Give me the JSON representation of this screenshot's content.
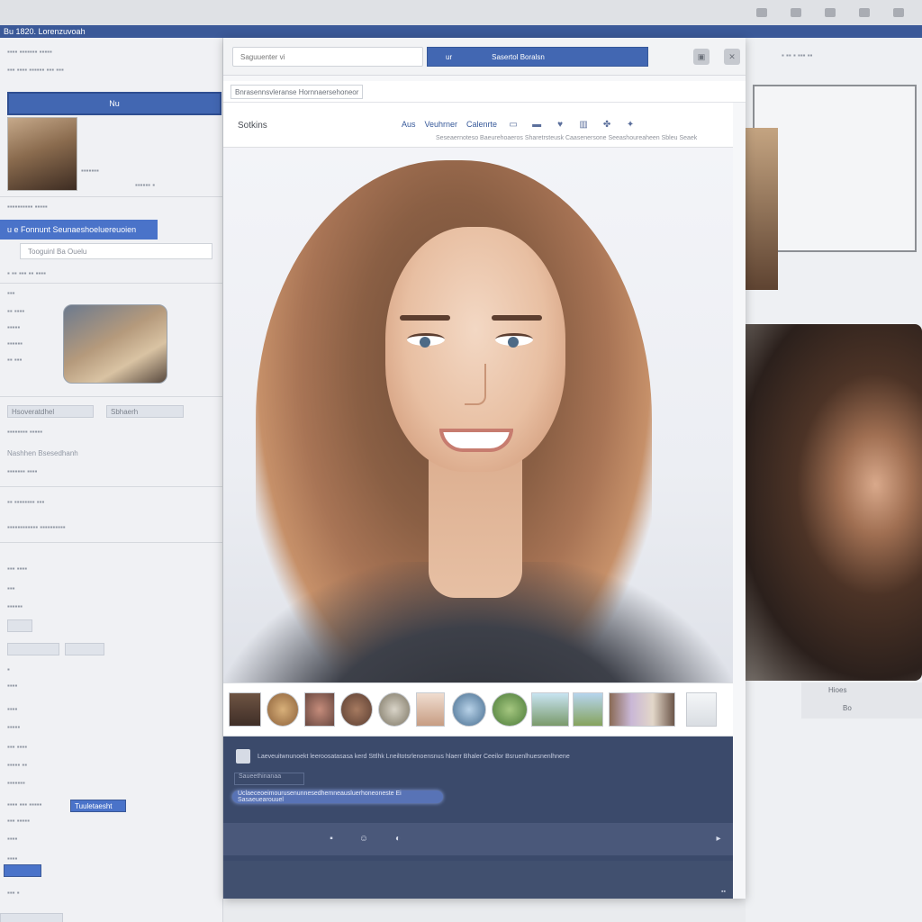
{
  "browser": {
    "title": ""
  },
  "top_bar": {
    "label": "Bu 1820. Lorenzuvoah"
  },
  "left_panel": {
    "header_label": "Nu",
    "tag_label": "u e Fonnunt Seunaeshoeluereuoien",
    "search_placeholder": "Tooguinl Ba Ouelu",
    "caption_1": "Nashhen Bsesedhanh",
    "chip_1": "Hsoveratdhel",
    "chip_2": "Sbhaerh",
    "bottom_tag": "Tuuletaesht"
  },
  "modal": {
    "search_placeholder": "Saguuenter vi",
    "blue_btn_left": "ur",
    "blue_btn_label": "Sasertol Boralsn",
    "breadcrumb": "Bnrasennsvleranse Hornnaersehoneor",
    "photo_title": "Sotkins",
    "nav_item_1": "Aus",
    "nav_item_2": "Veuhrner",
    "nav_item_3": "Calenrte",
    "nav_subtitle": "Seseaernoteso Baeurehoaeros Sharetrsteusk Caasenersone Seeashoureaheen Sbleu Seaek",
    "comment_text": "Laeveuitwnunoekt leeroosatasasa kerd Sttlhk Lneiltotsrlenoensnus hlaerr Bhaler Ceeilor Bsruenlhuesnenlhnene",
    "comment_placeholder": "Saueethinanaa",
    "comment_pill": "Uclaeceoeimourusenunnesedhemneausluerhoneoneste Ei Sasaeuearouuel"
  },
  "right_panel": {
    "caption_1": "Hioes",
    "caption_2": "Bo"
  },
  "icons": {
    "film": [
      "thumb-portrait-1",
      "thumb-round-1",
      "thumb-portrait-2",
      "thumb-round-2",
      "thumb-round-3",
      "thumb-portrait-3",
      "thumb-round-4",
      "thumb-round-5",
      "thumb-landscape-1",
      "thumb-landscape-2",
      "thumb-landscape-3",
      "thumb-landscape-4"
    ]
  },
  "colors": {
    "brand": "#3b5998",
    "accent": "#4267b2",
    "dark_panel": "#3b4a6b"
  }
}
